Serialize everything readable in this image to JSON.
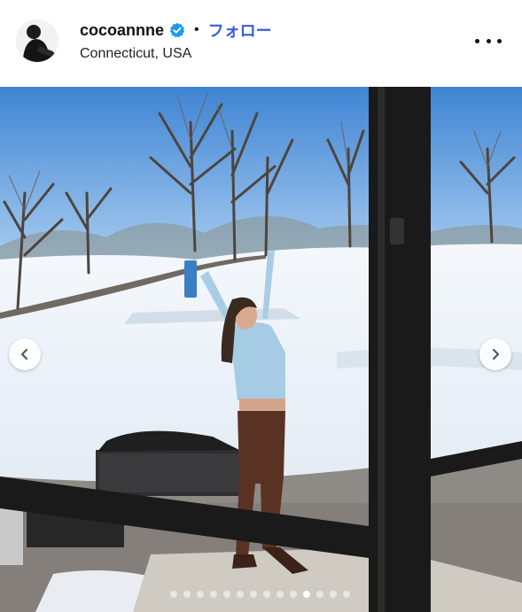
{
  "post": {
    "username": "cocoannne",
    "separator": "•",
    "follow_label": "フォロー",
    "location": "Connecticut, USA",
    "verified": true
  },
  "icons": {
    "avatar": "avatar",
    "verified": "verified-badge-icon",
    "more": "more-options-icon",
    "prev": "chevron-left-icon",
    "next": "chevron-right-icon"
  },
  "carousel": {
    "total": 14,
    "active_index": 10
  },
  "colors": {
    "follow_blue": "#3b5bdb",
    "verified_blue": "#1d9bf0"
  }
}
